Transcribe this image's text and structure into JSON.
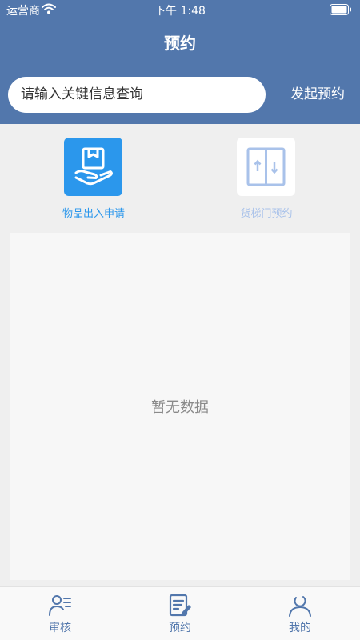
{
  "status_bar": {
    "carrier": "运营商",
    "time": "下午 1:48"
  },
  "header": {
    "title": "预约"
  },
  "search": {
    "placeholder": "请输入关键信息查询",
    "action_label": "发起预约"
  },
  "menu": [
    {
      "label": "物品出入申请",
      "icon": "box-hand-icon",
      "color": "#2b97ec"
    },
    {
      "label": "货梯门预约",
      "icon": "elevator-icon",
      "color": "#a9c2ea"
    }
  ],
  "content": {
    "empty_text": "暂无数据"
  },
  "tabbar": [
    {
      "label": "审核",
      "icon": "person-list-icon"
    },
    {
      "label": "预约",
      "icon": "edit-note-icon"
    },
    {
      "label": "我的",
      "icon": "user-icon"
    }
  ],
  "colors": {
    "header_bg": "#5277ac",
    "accent": "#2b97ec",
    "tab_active": "#5277ac"
  }
}
